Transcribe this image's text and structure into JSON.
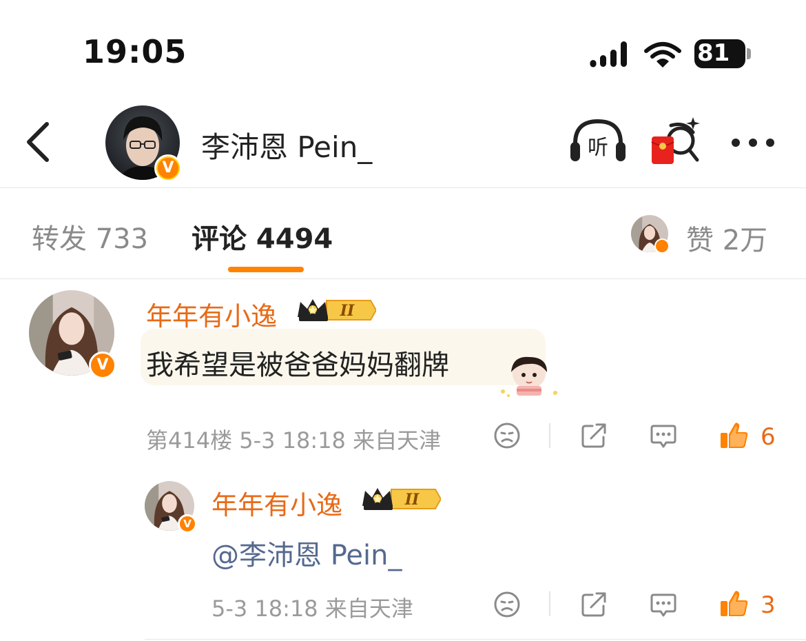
{
  "status_bar": {
    "time": "19:05",
    "battery": "81",
    "icons": [
      "cellular-signal-icon",
      "wifi-icon",
      "battery-charging-icon"
    ]
  },
  "header": {
    "back_icon": "chevron-left-icon",
    "username": "李沛恩 Pein_",
    "verified_badge": "V",
    "listen_label": "听",
    "icons": [
      "headphones-listen-icon",
      "red-packet-search-icon",
      "more-dots-icon"
    ]
  },
  "tabs": {
    "repost": "转发 733",
    "comment": "评论 4494",
    "likes": "赞 2万",
    "active": "comment",
    "accent": "#ff8200"
  },
  "comments": [
    {
      "username": "年年有小逸",
      "badge": "II",
      "verified_badge": "V",
      "text": "我希望是被爸爸妈妈翻牌",
      "floor": "第414楼",
      "meta": "第414楼 5-3 18:18 来自天津",
      "likes": "6",
      "sticker": "chibi-boy-sticker"
    },
    {
      "username": "年年有小逸",
      "badge": "II",
      "verified_badge": "V",
      "text": "@李沛恩 Pein_",
      "meta": "5-3 18:18 来自天津",
      "likes": "3"
    }
  ],
  "colors": {
    "username": "#e86a17",
    "mention": "#55698f",
    "meta": "#9a9a9a"
  }
}
